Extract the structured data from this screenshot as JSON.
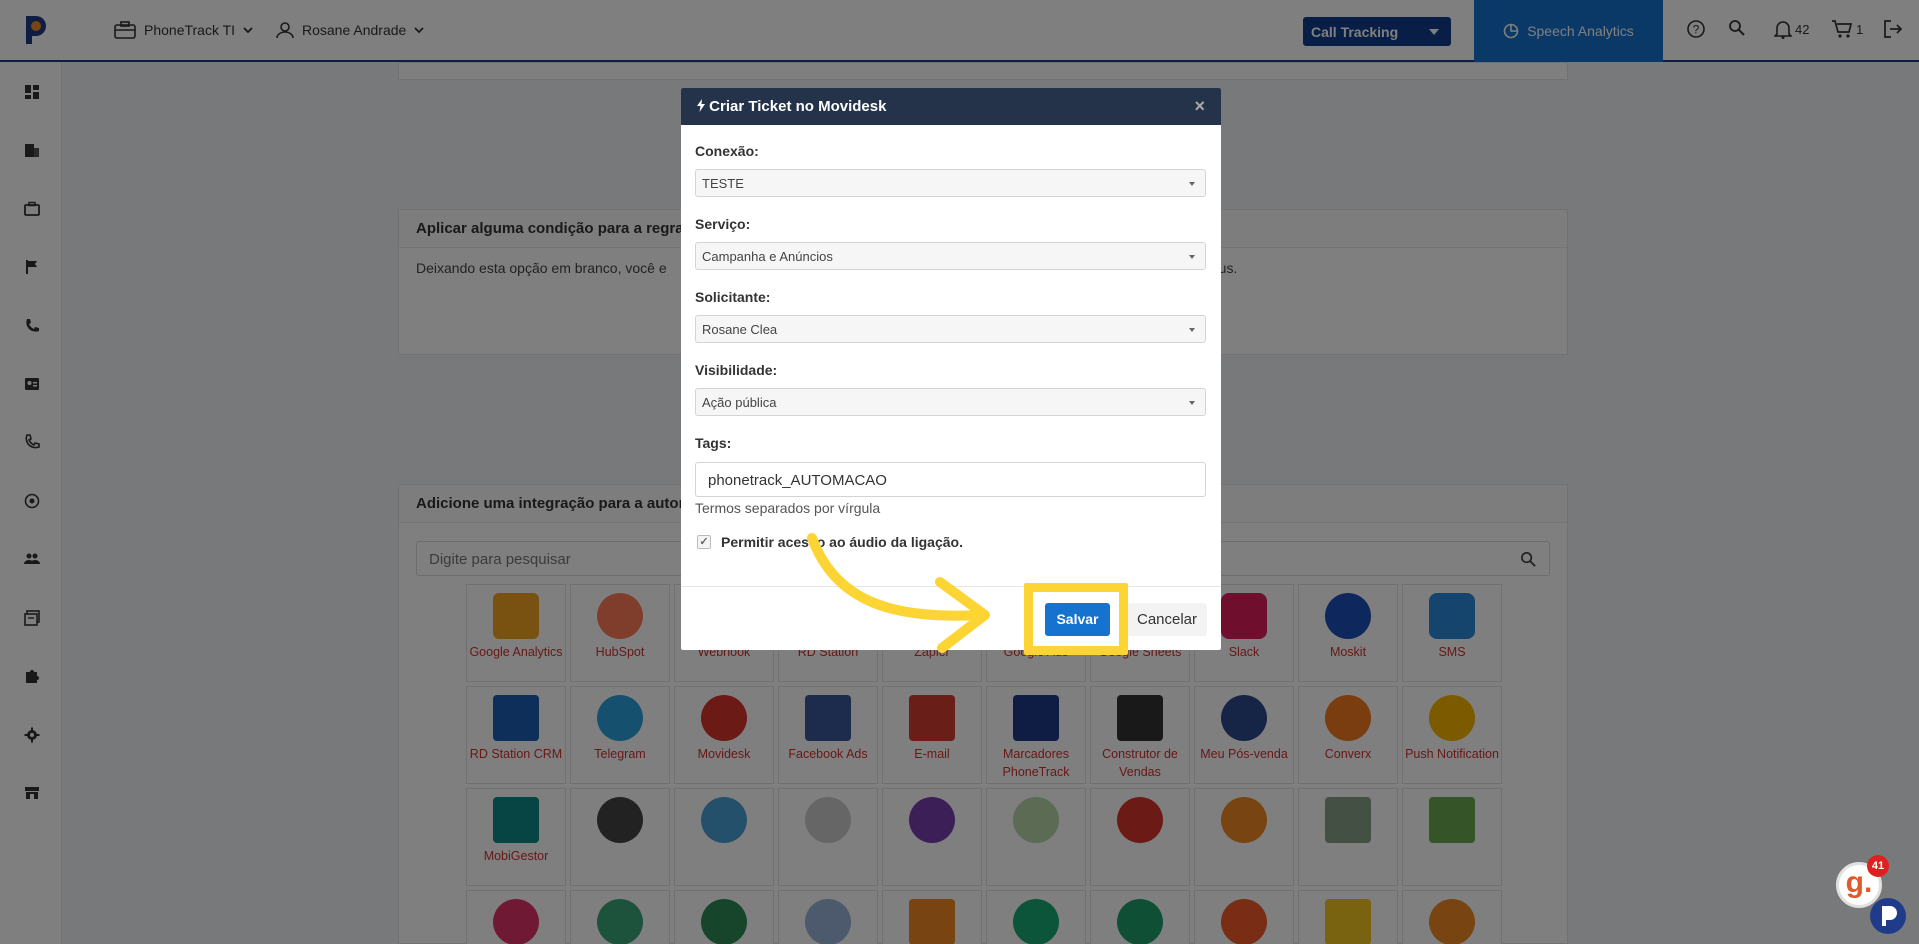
{
  "topbar": {
    "company_label": "PhoneTrack TI",
    "user_label": "Rosane Andrade",
    "call_tracking_label": "Call Tracking",
    "speech_analytics_label": "Speech Analytics",
    "notifications_count": "42",
    "cart_count": "1"
  },
  "sidebar": {
    "icons": [
      "dashboard-icon",
      "building-icon",
      "briefcase-icon",
      "flag-icon",
      "phone-icon",
      "contact-card-icon",
      "phone-call-icon",
      "target-icon",
      "users-icon",
      "books-icon",
      "puzzle-icon",
      "gear-icon",
      "store-icon"
    ]
  },
  "background": {
    "conditions_title": "Aplicar alguma condição para a regra",
    "conditions_text": "Deixando esta opção em branco, você e",
    "conditions_text_tail": "atus.",
    "integration_title": "Adicione uma integração para a autor",
    "search_placeholder": "Digite para pesquisar",
    "integrations_row1": [
      "Google Analytics",
      "HubSpot",
      "Webhook",
      "RD Station",
      "Zapier",
      "Google Ads",
      "Google Sheets",
      "Slack",
      "Moskit",
      "SMS"
    ],
    "integrations_row2": [
      "RD Station CRM",
      "Telegram",
      "Movidesk",
      "Facebook Ads",
      "E-mail",
      "Marcadores PhoneTrack",
      "Construtor de Vendas",
      "Meu Pós-venda",
      "Converx",
      "Push Notification"
    ],
    "integrations_row3": [
      "MobiGestor"
    ]
  },
  "modal": {
    "title": "Criar Ticket no Movidesk",
    "close_symbol": "×",
    "fields": [
      {
        "label": "Conexão:",
        "value": "TESTE"
      },
      {
        "label": "Serviço:",
        "value": "Campanha e Anúncios"
      },
      {
        "label": "Solicitante:",
        "value": "Rosane Clea"
      },
      {
        "label": "Visibilidade:",
        "value": "Ação pública"
      }
    ],
    "tags_label": "Tags:",
    "tags_value": "phonetrack_AUTOMACAO",
    "tags_hint": "Termos separados por vírgula",
    "checkbox_label": "Permitir acesso ao áudio da ligação.",
    "save_label": "Salvar",
    "cancel_label": "Cancelar"
  },
  "badge": {
    "letter": "g.",
    "count": "41"
  },
  "colors": {
    "primary_blue": "#1573cf",
    "navy": "#123c8e",
    "highlight_yellow": "#fcd535",
    "modal_header": "#24324a"
  }
}
